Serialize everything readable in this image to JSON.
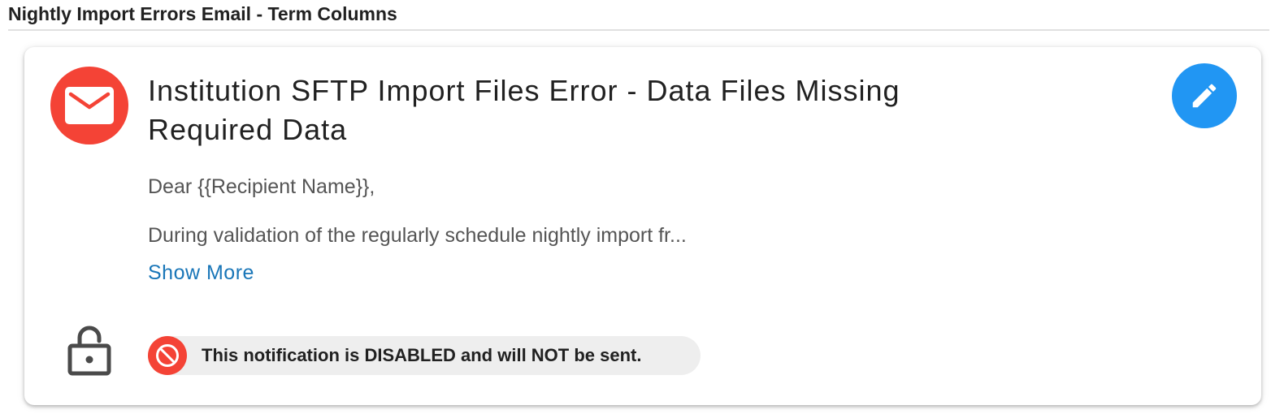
{
  "section": {
    "title": "Nightly Import Errors Email - Term Columns"
  },
  "card": {
    "title": "Institution SFTP Import Files Error - Data Files Missing Required Data",
    "greeting": "Dear {{Recipient Name}},",
    "preview": "During validation of the regularly schedule nightly import fr...",
    "show_more_label": "Show More",
    "status_text": "This notification is DISABLED and will NOT be sent."
  },
  "icons": {
    "avatar": "mail-icon",
    "edit": "pencil-icon",
    "lock": "lock-open-icon",
    "status": "block-icon"
  },
  "colors": {
    "avatar_bg": "#f44336",
    "edit_bg": "#2196f3",
    "link": "#1976b8",
    "status_icon_bg": "#f44336",
    "chip_bg": "#eeeeee"
  }
}
